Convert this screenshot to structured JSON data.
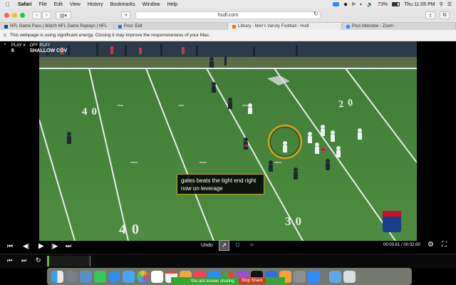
{
  "menubar": {
    "apple": "",
    "items": [
      "Safari",
      "File",
      "Edit",
      "View",
      "History",
      "Bookmarks",
      "Window",
      "Help"
    ],
    "battery": "73%",
    "clock": "Thu 11:05 PM"
  },
  "toolbar": {
    "address": "hudl.com"
  },
  "tabs": [
    {
      "label": "NFL Game Pass | Watch NFL Game Replays | NFL",
      "color": "#1d3f8a"
    },
    {
      "label": "Post: Edit",
      "color": "#2a6fd6"
    },
    {
      "label": "Library - Men's Varsity Football - Hudl",
      "color": "#ff6a00"
    },
    {
      "label": "Post Attendee - Zoom",
      "color": "#2d8cff"
    }
  ],
  "energy": {
    "message": "This webpage is using significant energy. Closing it may improve the responsiveness of your Mac."
  },
  "video": {
    "play_label": "PLAY #",
    "play_number": "8",
    "off_play_label": "OFF PLAY",
    "off_play_value": "SHALLOW COV",
    "caption": "gates beats the tight end right now on leverage",
    "yard_top_left": "40",
    "yard_top_right": "20",
    "yard_bottom_left": "40",
    "yard_bottom_right": "30",
    "undo_label": "Undo",
    "time_current": "00:03.61",
    "time_total": "00:32.00",
    "highlight_color": "#d4a017"
  },
  "sharing": {
    "message": "You are screen sharing",
    "stop_label": "Stop Share"
  }
}
